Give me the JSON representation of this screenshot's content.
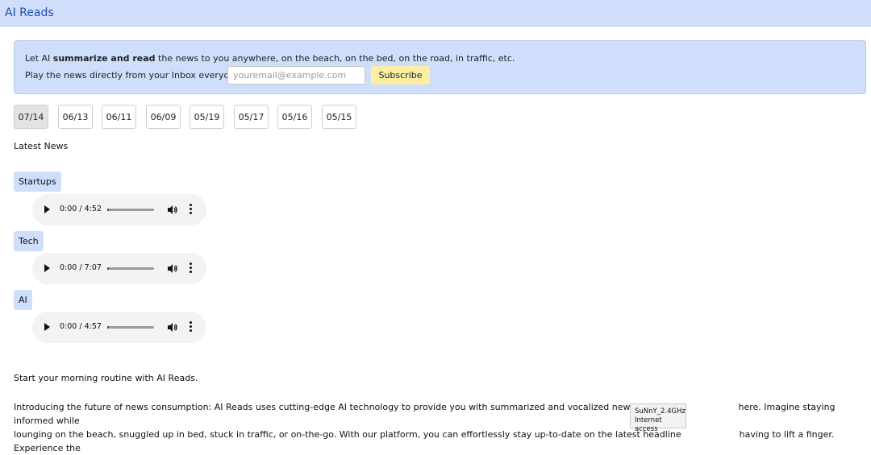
{
  "app": {
    "title": "AI Reads"
  },
  "banner": {
    "line1_prefix": "Let AI ",
    "line1_bold": "summarize and read",
    "line1_suffix": " the news to you anywhere, on the beach, on the bed, on the road, in traffic, etc.",
    "line2_label": "Play the news directly from your Inbox everyday:",
    "email_placeholder": "youremail@example.com",
    "subscribe_label": "Subscribe"
  },
  "dates": [
    "07/14",
    "06/13",
    "06/11",
    "06/09",
    "05/19",
    "05/17",
    "05/16",
    "05/15"
  ],
  "active_date": "07/14",
  "latest_news_heading": "Latest News",
  "categories": [
    {
      "label": "Startups",
      "time": "0:00 / 4:52",
      "progress": 0
    },
    {
      "label": "Tech",
      "time": "0:00 / 7:07",
      "progress": 0
    },
    {
      "label": "AI",
      "time": "0:00 / 4:57",
      "progress": 0
    }
  ],
  "intro_text": "Start your morning routine with AI Reads.",
  "paragraph": {
    "line1_a": "Introducing the future of news consumption: AI Reads uses cutting-edge AI technology to provide you with summarized and vocalized news updates a",
    "line1_b": "here. Imagine staying informed while",
    "line2_a": "lounging on the beach, snuggled up in bed, stuck in traffic, or on-the-go. With our platform, you can effortlessly stay up-to-date on the latest headline",
    "line2_b": "having to lift a finger. Experience the"
  },
  "tooltip": {
    "network": "SuNnY_2.4GHz",
    "status": "Internet access"
  }
}
